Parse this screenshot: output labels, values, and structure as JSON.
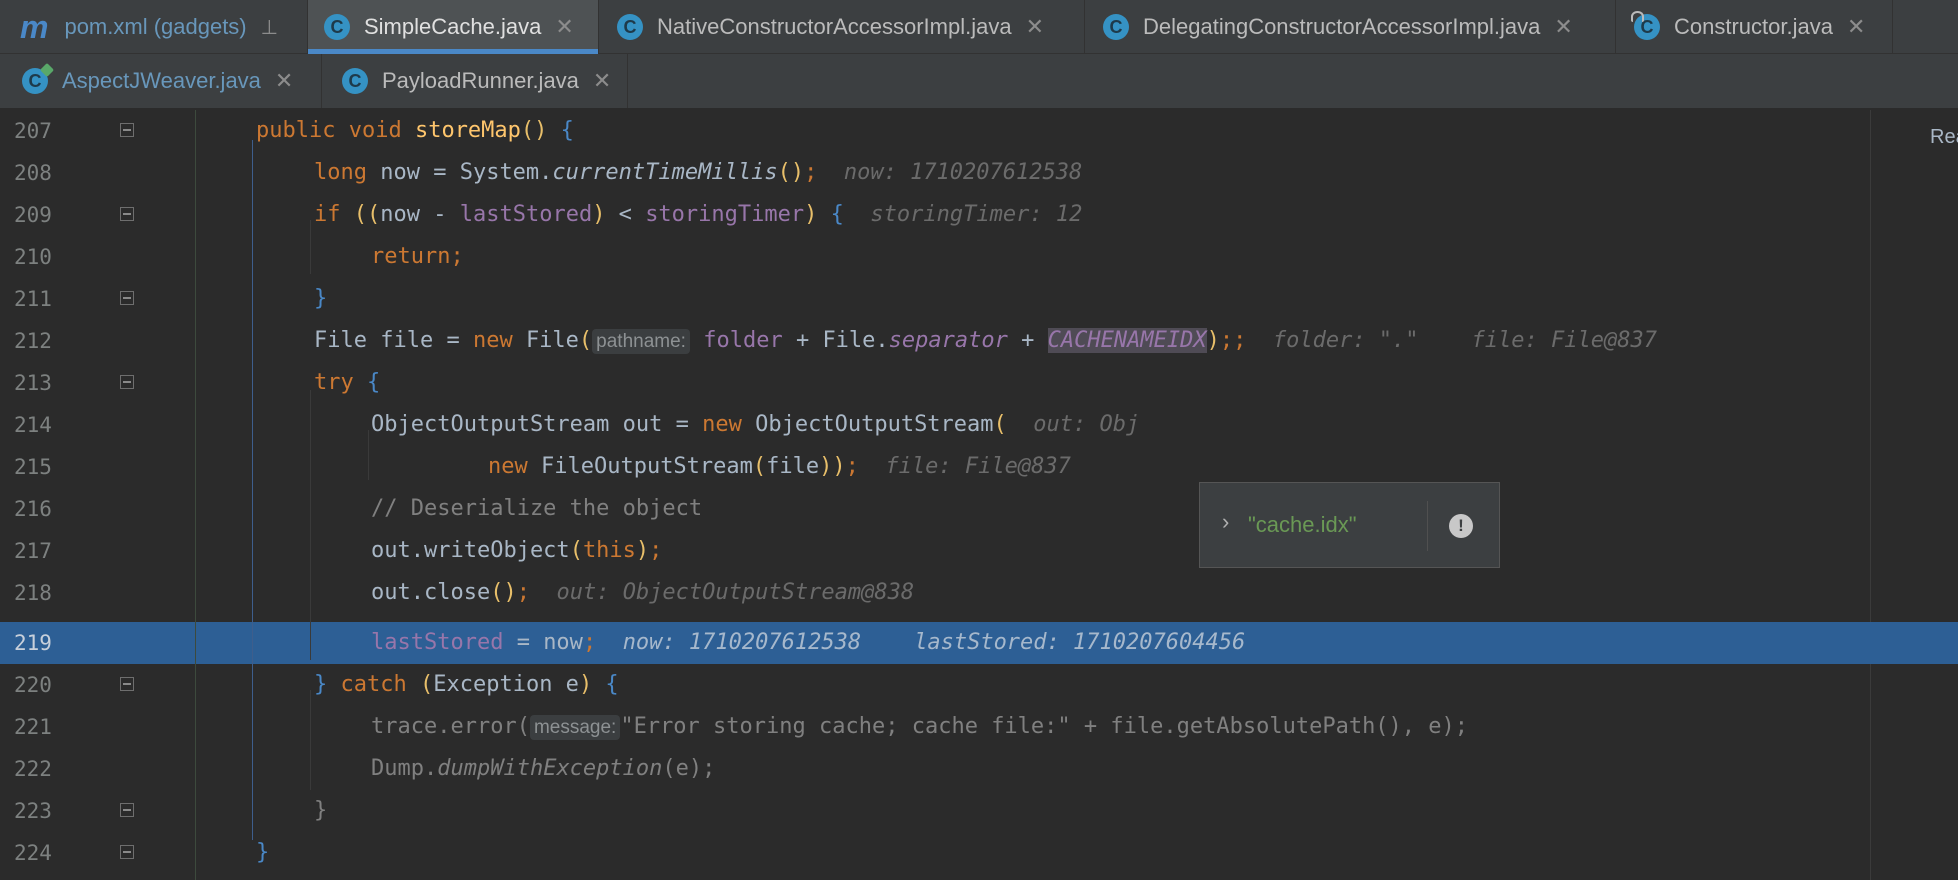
{
  "tabs_row1": [
    {
      "label": "pom.xml (gadgets)",
      "icon": "maven-icon",
      "pinned": true
    },
    {
      "label": "SimpleCache.java",
      "icon": "java-class-icon",
      "active": true
    },
    {
      "label": "NativeConstructorAccessorImpl.java",
      "icon": "java-class-icon"
    },
    {
      "label": "DelegatingConstructorAccessorImpl.java",
      "icon": "java-class-icon"
    },
    {
      "label": "Constructor.java",
      "icon": "java-class-locked-icon"
    }
  ],
  "tabs_row2": [
    {
      "label": "AspectJWeaver.java",
      "icon": "java-runnable-class-icon"
    },
    {
      "label": "PayloadRunner.java",
      "icon": "java-class-icon"
    }
  ],
  "reader_mode": "Rea",
  "lines": {
    "l207": "207",
    "l208": "208",
    "l209": "209",
    "l210": "210",
    "l211": "211",
    "l212": "212",
    "l213": "213",
    "l214": "214",
    "l215": "215",
    "l216": "216",
    "l217": "217",
    "l218": "218",
    "l219": "219",
    "l220": "220",
    "l221": "221",
    "l222": "222",
    "l223": "223",
    "l224": "224"
  },
  "code": {
    "c207": {
      "mod": "public void ",
      "name": "storeMap",
      "p": "()",
      "b": " {"
    },
    "c208": {
      "kw": "long ",
      "a": "now = System.",
      "m": "currentTimeMillis",
      "p": "()",
      "s": ";",
      "hint": "now: 1710207612538"
    },
    "c209": {
      "kw": "if ",
      "p1": "((",
      "a": "now - ",
      "f": "lastStored",
      "p2": ")",
      "b": " < ",
      "f2": "storingTimer",
      "p3": ")",
      "br": " {",
      "hint": "storingTimer: 12"
    },
    "c210": {
      "kw": "return;"
    },
    "c211": {
      "br": "}"
    },
    "c212": {
      "a": "File file = ",
      "kw": "new ",
      "cls": "File",
      "p": "(",
      "param": "pathname:",
      "f": "folder",
      "b": " + File.",
      "f2": "separator",
      "c": " + ",
      "cn": "CACHENAMEIDX",
      "p2": ")",
      "s": ";;",
      "hint1": "folder: \".\"",
      "hint2": "file: File@837"
    },
    "c213": {
      "kw": "try ",
      "br": "{"
    },
    "c214": {
      "a": "ObjectOutputStream out = ",
      "kw": "new ",
      "b": "ObjectOutputStream",
      "p": "(",
      "hint": "out: Obj"
    },
    "c215": {
      "kw": "new ",
      "a": "FileOutputStream",
      "p": "(",
      "b": "file",
      "p2": "))",
      "s": ";",
      "hint": "file: File@837"
    },
    "c216": {
      "cmt": "// Deserialize the object"
    },
    "c217": {
      "a": "out.writeObject",
      "p": "(",
      "kw": "this",
      "p2": ")",
      "s": ";"
    },
    "c218": {
      "a": "out.close",
      "p": "()",
      "s": ";",
      "hint": "out: ObjectOutputStream@838"
    },
    "c219": {
      "f": "lastStored",
      "a": " = now",
      "s": ";",
      "hint1": "now: 1710207612538",
      "hint2": "lastStored: 1710207604456"
    },
    "c220": {
      "br": "} ",
      "kw": "catch ",
      "p": "(",
      "a": "Exception e",
      "p2": ")",
      "br2": " {"
    },
    "c221": {
      "a": "trace.error(",
      "param": "message:",
      "s": "\"Error storing cache; cache file:\"",
      "b": " + file.getAbsolutePath(), e);"
    },
    "c222": {
      "a": "Dump.",
      "m": "dumpWithException",
      "b": "(e);"
    },
    "c223": {
      "br": "}"
    },
    "c224": {
      "br": "}"
    }
  },
  "popup": {
    "value": "\"cache.idx\"",
    "expand_icon": "chevron-right-icon",
    "warn_icon": "warning-icon"
  }
}
